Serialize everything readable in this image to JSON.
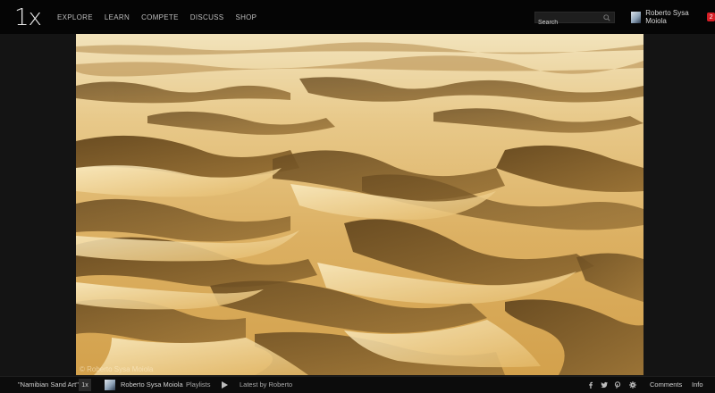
{
  "logo": "1x",
  "nav": [
    {
      "label": "EXPLORE"
    },
    {
      "label": "LEARN"
    },
    {
      "label": "COMPETE"
    },
    {
      "label": "DISCUSS"
    },
    {
      "label": "SHOP"
    }
  ],
  "search": {
    "placeholder": "Search",
    "icon": "search-icon"
  },
  "user": {
    "name": "Roberto Sysa Moiola",
    "notifications": "2"
  },
  "photo": {
    "watermark": "© Roberto Sysa Moiola"
  },
  "bottom": {
    "title": "\"Namibian Sand Art\"",
    "site_tag": "1x",
    "author": "Roberto Sysa Moiola",
    "playlists": "Playlists",
    "latest": "Latest by Roberto",
    "comments": "Comments",
    "info": "Info",
    "icons": [
      "facebook-icon",
      "twitter-icon",
      "pinterest-icon",
      "gear-icon"
    ]
  },
  "colors": {
    "badge": "#d61f26",
    "sand_light": "#f3dca0",
    "sand_mid": "#d9ad5a",
    "shadow": "#5a4220"
  }
}
